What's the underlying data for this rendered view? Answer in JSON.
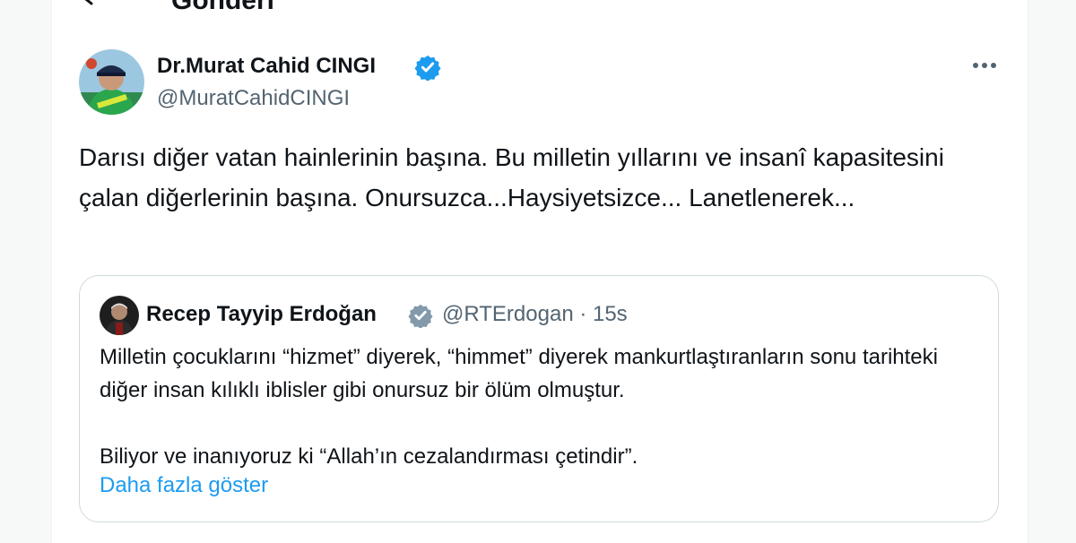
{
  "header": {
    "title": "Gönderi"
  },
  "tweet": {
    "author_name": "Dr.Murat Cahid CINGI",
    "author_handle": "@MuratCahidCINGI",
    "text": "Darısı diğer vatan hainlerinin başına. Bu milletin yıllarını ve insanî kapasitesini çalan diğerlerinin başına. Onursuzca...Haysiyetsizce... Lanetlenerek...",
    "verified_badge_color": "#1d9bf0"
  },
  "quoted_tweet": {
    "author_name": "Recep Tayyip Erdoğan",
    "meta": "@RTErdogan · 15s",
    "paragraph_1": "Milletin çocuklarını “hizmet” diyerek, “himmet” diyerek mankurtlaştıranların sonu tarihteki diğer insan kılıklı iblisler gibi onursuz bir ölüm olmuştur.",
    "paragraph_2": "Biliyor ve inanıyoruz ki “Allah’ın cezalandırması çetindir”.",
    "show_more": "Daha fazla göster",
    "verified_badge_color": "#829aab"
  },
  "colors": {
    "link": "#1d9bf0",
    "secondary_text": "#536471",
    "border": "#cfd9de"
  },
  "icons": {
    "back": "arrow-left-icon",
    "more": "more-horizontal-icon",
    "verified": "verified-badge-icon"
  }
}
